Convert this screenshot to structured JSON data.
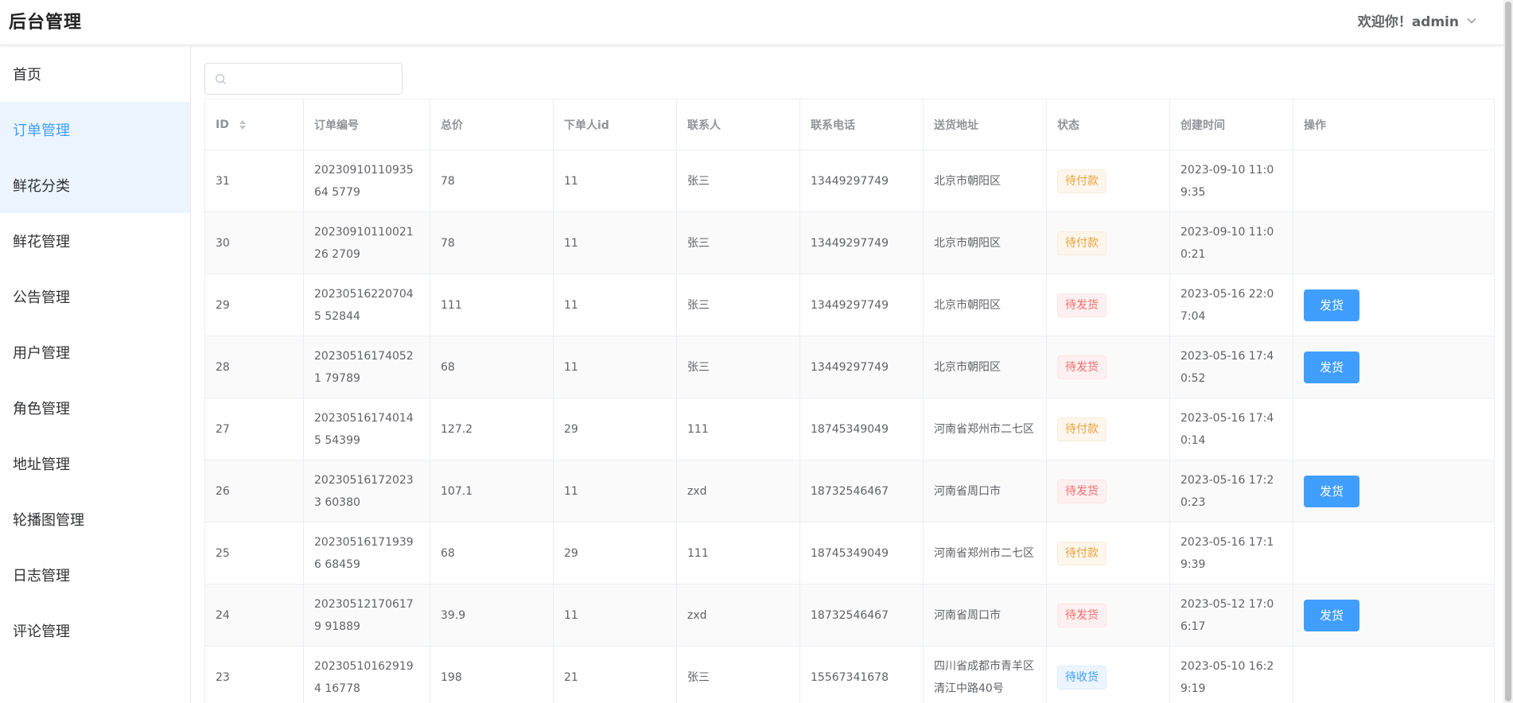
{
  "header": {
    "app_title": "后台管理",
    "welcome_text": "欢迎你！admin"
  },
  "sidebar": {
    "items": [
      {
        "label": "首页",
        "name": "sidebar-item-home",
        "state": ""
      },
      {
        "label": "订单管理",
        "name": "sidebar-item-orders",
        "state": "active"
      },
      {
        "label": "鲜花分类",
        "name": "sidebar-item-flower-category",
        "state": "hover"
      },
      {
        "label": "鲜花管理",
        "name": "sidebar-item-flowers",
        "state": ""
      },
      {
        "label": "公告管理",
        "name": "sidebar-item-announcements",
        "state": ""
      },
      {
        "label": "用户管理",
        "name": "sidebar-item-users",
        "state": ""
      },
      {
        "label": "角色管理",
        "name": "sidebar-item-roles",
        "state": ""
      },
      {
        "label": "地址管理",
        "name": "sidebar-item-addresses",
        "state": ""
      },
      {
        "label": "轮播图管理",
        "name": "sidebar-item-carousel",
        "state": ""
      },
      {
        "label": "日志管理",
        "name": "sidebar-item-logs",
        "state": ""
      },
      {
        "label": "评论管理",
        "name": "sidebar-item-comments",
        "state": ""
      }
    ]
  },
  "search": {
    "placeholder": "",
    "value": ""
  },
  "table": {
    "columns": [
      "ID",
      "订单编号",
      "总价",
      "下单人id",
      "联系人",
      "联系电话",
      "送货地址",
      "状态",
      "创建时间",
      "操作"
    ],
    "ship_button_label": "发货",
    "rows": [
      {
        "id": "31",
        "order_no": "2023091011093564 5779",
        "total": "78",
        "user_id": "11",
        "contact": "张三",
        "phone": "13449297749",
        "address": "北京市朝阳区",
        "status": "待付款",
        "status_type": "warning",
        "created": "2023-09-10 11:09:35",
        "can_ship": false
      },
      {
        "id": "30",
        "order_no": "2023091011002126 2709",
        "total": "78",
        "user_id": "11",
        "contact": "张三",
        "phone": "13449297749",
        "address": "北京市朝阳区",
        "status": "待付款",
        "status_type": "warning",
        "created": "2023-09-10 11:00:21",
        "can_ship": false
      },
      {
        "id": "29",
        "order_no": "202305162207045 52844",
        "total": "111",
        "user_id": "11",
        "contact": "张三",
        "phone": "13449297749",
        "address": "北京市朝阳区",
        "status": "待发货",
        "status_type": "danger",
        "created": "2023-05-16 22:07:04",
        "can_ship": true
      },
      {
        "id": "28",
        "order_no": "202305161740521 79789",
        "total": "68",
        "user_id": "11",
        "contact": "张三",
        "phone": "13449297749",
        "address": "北京市朝阳区",
        "status": "待发货",
        "status_type": "danger",
        "created": "2023-05-16 17:40:52",
        "can_ship": true
      },
      {
        "id": "27",
        "order_no": "202305161740145 54399",
        "total": "127.2",
        "user_id": "29",
        "contact": "111",
        "phone": "18745349049",
        "address": "河南省郑州市二七区",
        "status": "待付款",
        "status_type": "warning",
        "created": "2023-05-16 17:40:14",
        "can_ship": false
      },
      {
        "id": "26",
        "order_no": "202305161720233 60380",
        "total": "107.1",
        "user_id": "11",
        "contact": "zxd",
        "phone": "18732546467",
        "address": "河南省周口市",
        "status": "待发货",
        "status_type": "danger",
        "created": "2023-05-16 17:20:23",
        "can_ship": true
      },
      {
        "id": "25",
        "order_no": "202305161719396 68459",
        "total": "68",
        "user_id": "29",
        "contact": "111",
        "phone": "18745349049",
        "address": "河南省郑州市二七区",
        "status": "待付款",
        "status_type": "warning",
        "created": "2023-05-16 17:19:39",
        "can_ship": false
      },
      {
        "id": "24",
        "order_no": "202305121706179 91889",
        "total": "39.9",
        "user_id": "11",
        "contact": "zxd",
        "phone": "18732546467",
        "address": "河南省周口市",
        "status": "待发货",
        "status_type": "danger",
        "created": "2023-05-12 17:06:17",
        "can_ship": true
      },
      {
        "id": "23",
        "order_no": "202305101629194 16778",
        "total": "198",
        "user_id": "21",
        "contact": "张三",
        "phone": "15567341678",
        "address": "四川省成都市青羊区清江中路40号",
        "status": "待收货",
        "status_type": "info",
        "created": "2023-05-10 16:29:19",
        "can_ship": false
      }
    ]
  },
  "colors": {
    "accent": "#409eff",
    "active_menu_bg": "#ecf5ff",
    "warning": "#e6a23c",
    "danger": "#f56c6c"
  },
  "icons": {
    "search": "search-icon",
    "dropdown": "chevron-down-icon",
    "sort": "sort-caret-icon"
  }
}
